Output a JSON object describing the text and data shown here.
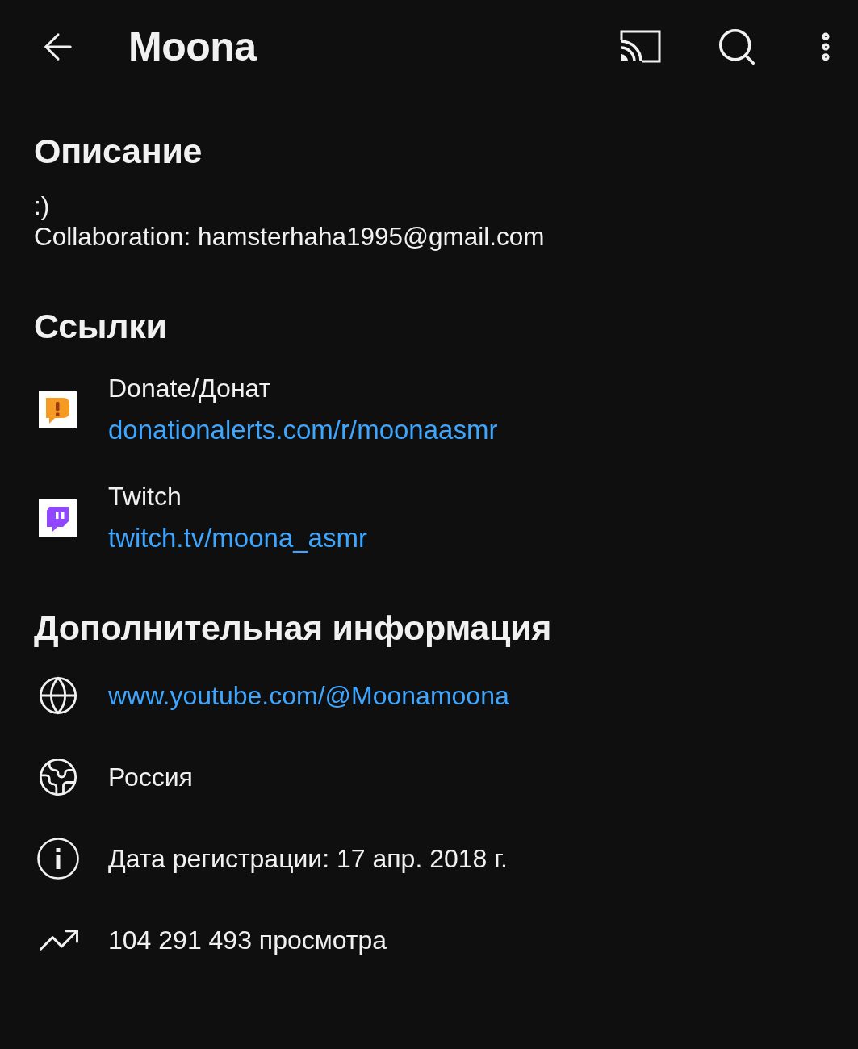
{
  "app_bar": {
    "title": "Moona"
  },
  "description": {
    "heading": "Описание",
    "lines": [
      ":)",
      "Collaboration: hamsterhaha1995@gmail.com"
    ]
  },
  "links": {
    "heading": "Ссылки",
    "items": [
      {
        "kind": "donationalerts",
        "title": "Donate/Донат",
        "url": "donationalerts.com/r/moonaasmr"
      },
      {
        "kind": "twitch",
        "title": "Twitch",
        "url": "twitch.tv/moona_asmr"
      }
    ]
  },
  "more_info": {
    "heading": "Дополнительная информация",
    "items": [
      {
        "kind": "website",
        "text": "www.youtube.com/@Moonamoona"
      },
      {
        "kind": "country",
        "text": "Россия"
      },
      {
        "kind": "joined",
        "text": "Дата регистрации: 17 апр. 2018 г."
      },
      {
        "kind": "views",
        "text": "104 291 493 просмотра"
      }
    ]
  }
}
